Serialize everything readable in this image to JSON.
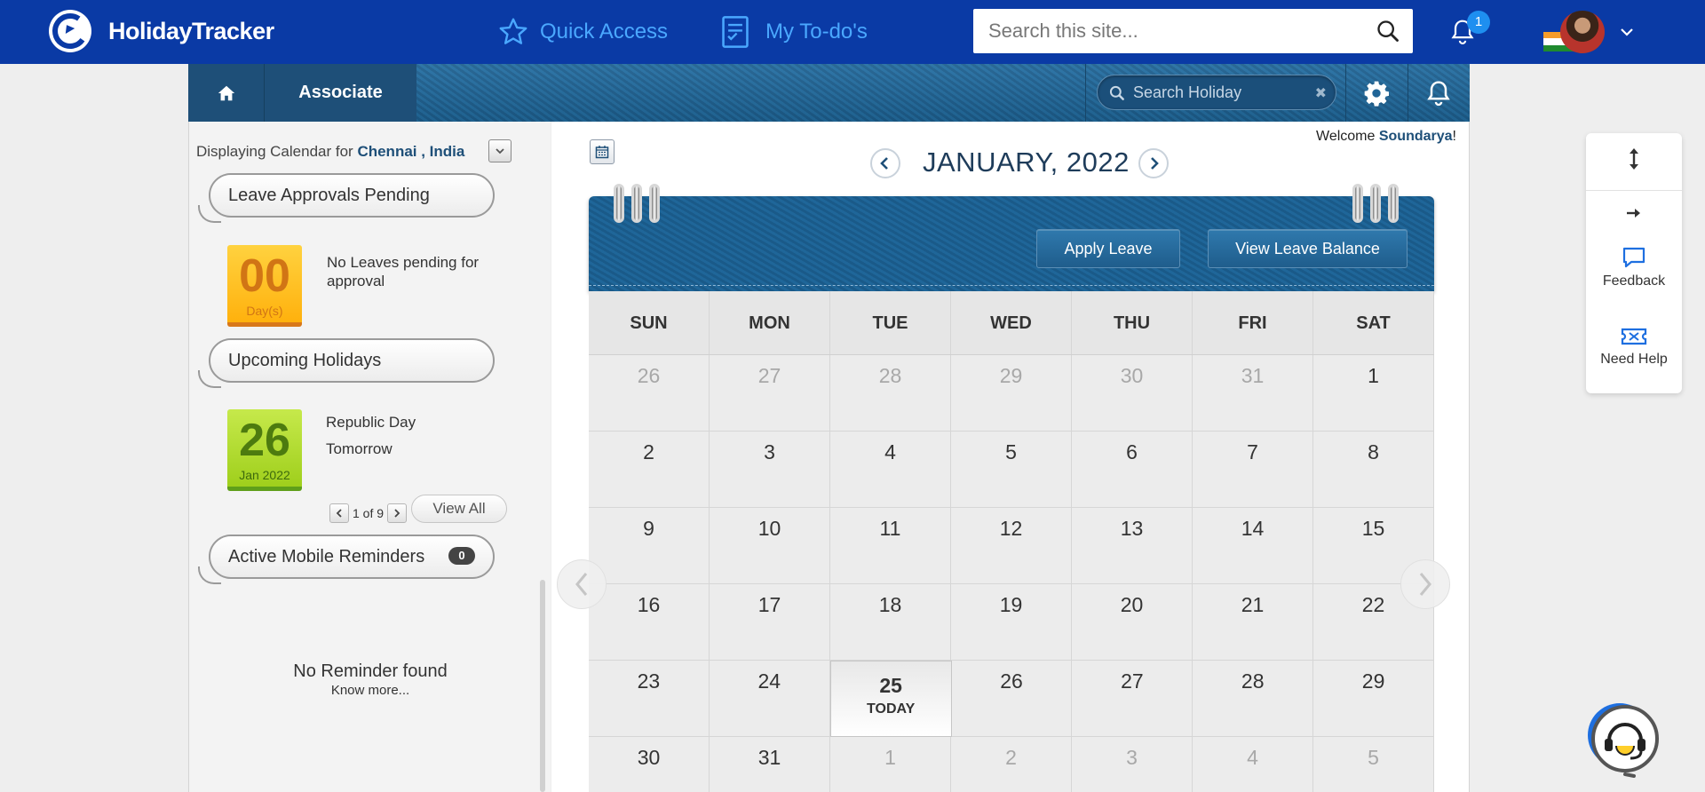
{
  "header": {
    "app_name": "HolidayTracker",
    "quick_access": "Quick Access",
    "todos": "My To-do's",
    "search_placeholder": "Search this site...",
    "notification_count": "1"
  },
  "appnav": {
    "tab_associate": "Associate",
    "holiday_search_placeholder": "Search Holiday"
  },
  "left": {
    "displaying_prefix": "Displaying Calendar for",
    "location": "Chennai , India",
    "leave_approvals": {
      "title": "Leave Approvals Pending",
      "count": "00",
      "unit": "Day(s)",
      "message": "No Leaves pending for approval"
    },
    "upcoming": {
      "title": "Upcoming Holidays",
      "day": "26",
      "month_year": "Jan 2022",
      "name": "Republic Day",
      "when": "Tomorrow",
      "pager": "1 of 9",
      "view_all": "View All"
    },
    "reminders": {
      "title": "Active Mobile Reminders",
      "count": "0",
      "empty": "No Reminder found",
      "know_more": "Know more..."
    }
  },
  "calendar": {
    "welcome_prefix": "Welcome",
    "user": "Soundarya",
    "welcome_suffix": "!",
    "month_label": "JANUARY, 2022",
    "apply_leave": "Apply Leave",
    "view_leave_balance": "View Leave Balance",
    "weekdays": [
      "SUN",
      "MON",
      "TUE",
      "WED",
      "THU",
      "FRI",
      "SAT"
    ],
    "today_label": "TODAY",
    "weeks": [
      [
        {
          "d": "26",
          "m": true
        },
        {
          "d": "27",
          "m": true
        },
        {
          "d": "28",
          "m": true
        },
        {
          "d": "29",
          "m": true
        },
        {
          "d": "30",
          "m": true
        },
        {
          "d": "31",
          "m": true
        },
        {
          "d": "1"
        }
      ],
      [
        {
          "d": "2"
        },
        {
          "d": "3"
        },
        {
          "d": "4"
        },
        {
          "d": "5"
        },
        {
          "d": "6"
        },
        {
          "d": "7"
        },
        {
          "d": "8"
        }
      ],
      [
        {
          "d": "9"
        },
        {
          "d": "10"
        },
        {
          "d": "11"
        },
        {
          "d": "12"
        },
        {
          "d": "13"
        },
        {
          "d": "14"
        },
        {
          "d": "15"
        }
      ],
      [
        {
          "d": "16"
        },
        {
          "d": "17"
        },
        {
          "d": "18"
        },
        {
          "d": "19"
        },
        {
          "d": "20"
        },
        {
          "d": "21"
        },
        {
          "d": "22"
        }
      ],
      [
        {
          "d": "23"
        },
        {
          "d": "24"
        },
        {
          "d": "25",
          "today": true
        },
        {
          "d": "26"
        },
        {
          "d": "27"
        },
        {
          "d": "28"
        },
        {
          "d": "29"
        }
      ],
      [
        {
          "d": "30"
        },
        {
          "d": "31"
        },
        {
          "d": "1",
          "m": true
        },
        {
          "d": "2",
          "m": true
        },
        {
          "d": "3",
          "m": true
        },
        {
          "d": "4",
          "m": true
        },
        {
          "d": "5",
          "m": true
        }
      ]
    ]
  },
  "float_panel": {
    "feedback": "Feedback",
    "need_help": "Need Help"
  },
  "colors": {
    "topbar": "#0a3aa5",
    "link_blue": "#4aa8ff",
    "nav_dark": "#1e4f78",
    "approval_tile": "#ffb10d",
    "holiday_tile": "#9fcf1c"
  }
}
